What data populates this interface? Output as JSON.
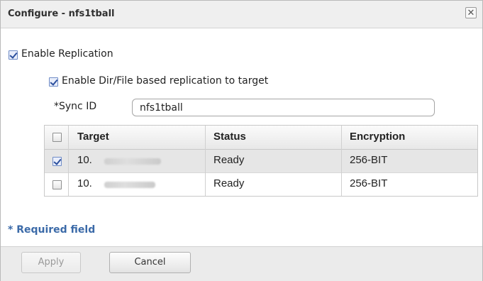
{
  "dialog": {
    "title": "Configure - nfs1tball",
    "close_label": "✕"
  },
  "form": {
    "enable_replication": {
      "label": "Enable Replication",
      "checked": true
    },
    "enable_dir_file": {
      "label": "Enable Dir/File based replication to target",
      "checked": true
    },
    "sync_id": {
      "label": "*Sync ID",
      "value": "nfs1tball"
    }
  },
  "table": {
    "headers": [
      "Target",
      "Status",
      "Encryption"
    ],
    "select_all_checked": false,
    "rows": [
      {
        "checked": true,
        "target": "10.",
        "status": "Ready",
        "encryption": "256-BIT"
      },
      {
        "checked": false,
        "target": "10.",
        "status": "Ready",
        "encryption": "256-BIT"
      }
    ]
  },
  "required_note": "* Required field",
  "footer": {
    "apply_label": "Apply",
    "cancel_label": "Cancel"
  },
  "colors": {
    "required_text": "#3b6aa8",
    "selected_row": "#e6e6e6"
  }
}
